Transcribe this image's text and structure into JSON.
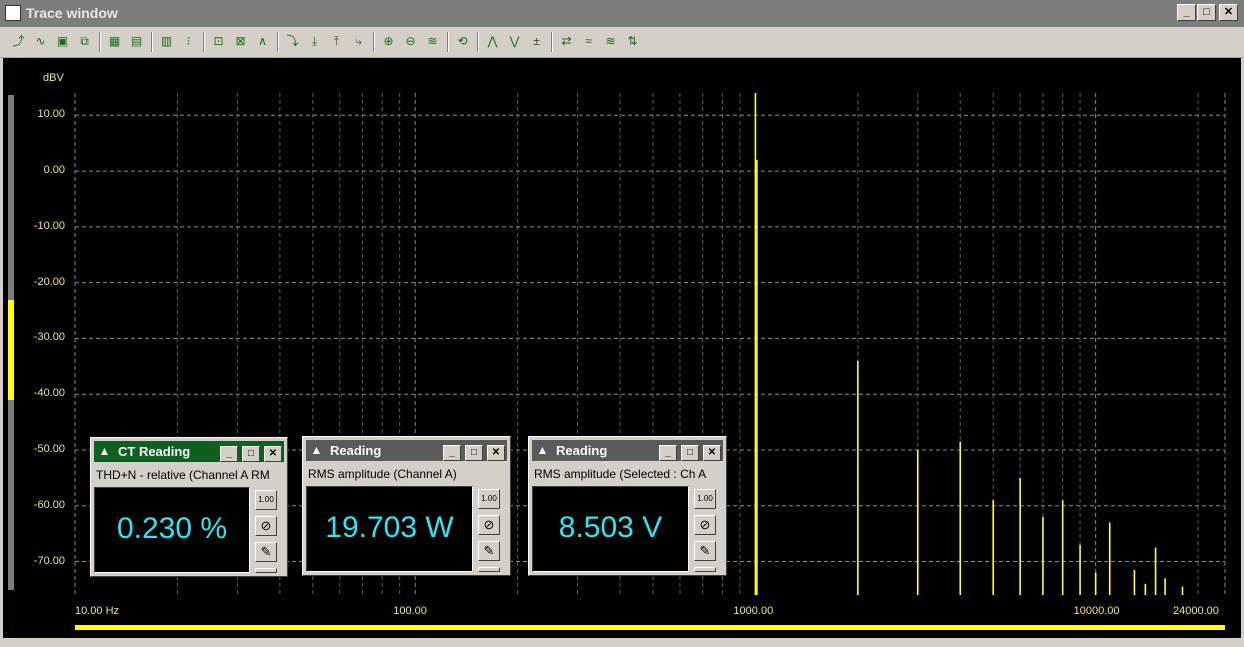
{
  "window": {
    "title": "Trace window"
  },
  "window_controls": {
    "minimize": "_",
    "maximize": "□",
    "close": "✕"
  },
  "toolbar": {
    "icons": [
      "add-trace-icon",
      "curve-icon",
      "save-icon",
      "copy-icon",
      "grid-icon",
      "print-icon",
      "properties-icon",
      "dots-icon",
      "zoom-fit-icon",
      "zoom-icon",
      "waveform-icon",
      "cursor-left-icon",
      "cursor-down-icon",
      "cursor-peak-icon",
      "cursor-right-icon",
      "zoom-in-icon",
      "zoom-out-icon",
      "scale-icon",
      "marker-icon",
      "peak-up-icon",
      "peak-down-icon",
      "offset-icon",
      "value-icon",
      "math-icon",
      "compare-icon",
      "swap-icon"
    ]
  },
  "chart_data": {
    "type": "line",
    "title": "",
    "xlabel": "",
    "ylabel": "dBV",
    "x_scale": "log",
    "xlim": [
      10,
      24000
    ],
    "ylim": [
      -76,
      14
    ],
    "x_ticks": [
      "10.00 Hz",
      "100.00",
      "1000.00",
      "10000.00",
      "24000.00"
    ],
    "y_ticks": [
      "10.00",
      "0.00",
      "-10.00",
      "-20.00",
      "-30.00",
      "-40.00",
      "-50.00",
      "-60.00",
      "-70.00"
    ],
    "grid": true,
    "series": [
      {
        "color": "#ffff33",
        "peaks": [
          {
            "x": 1000,
            "y": 14
          },
          {
            "x": 1010,
            "y": 2
          },
          {
            "x": 2000,
            "y": -34
          },
          {
            "x": 3000,
            "y": -50
          },
          {
            "x": 4000,
            "y": -48.5
          },
          {
            "x": 5000,
            "y": -59
          },
          {
            "x": 6000,
            "y": -55
          },
          {
            "x": 7000,
            "y": -62
          },
          {
            "x": 8000,
            "y": -59
          },
          {
            "x": 9000,
            "y": -67
          },
          {
            "x": 10000,
            "y": -72
          },
          {
            "x": 11000,
            "y": -63
          },
          {
            "x": 13000,
            "y": -71.5
          },
          {
            "x": 14000,
            "y": -74
          },
          {
            "x": 15000,
            "y": -67.5
          },
          {
            "x": 16000,
            "y": -73
          },
          {
            "x": 18000,
            "y": -74.5
          }
        ]
      }
    ]
  },
  "readings": [
    {
      "title": "CT Reading",
      "caption": "THD+N - relative (Channel A RM",
      "value": "0.230 %",
      "active": true,
      "side_buttons": [
        "1.00",
        "meter",
        "edit"
      ]
    },
    {
      "title": "Reading",
      "caption": "RMS amplitude (Channel A)",
      "value": "19.703 W",
      "active": false,
      "side_buttons": [
        "1.00",
        "meter",
        "edit"
      ]
    },
    {
      "title": "Reading",
      "caption": "RMS amplitude (Selected : Ch A",
      "value": "8.503 V",
      "active": false,
      "side_buttons": [
        "1.00",
        "meter",
        "edit"
      ]
    }
  ],
  "reading_controls": {
    "minimize": "_",
    "maximize": "□",
    "close": "✕"
  },
  "reading_side": {
    "scale_label": "1.00",
    "meter_glyph": "⊘",
    "edit_glyph": "✎"
  }
}
